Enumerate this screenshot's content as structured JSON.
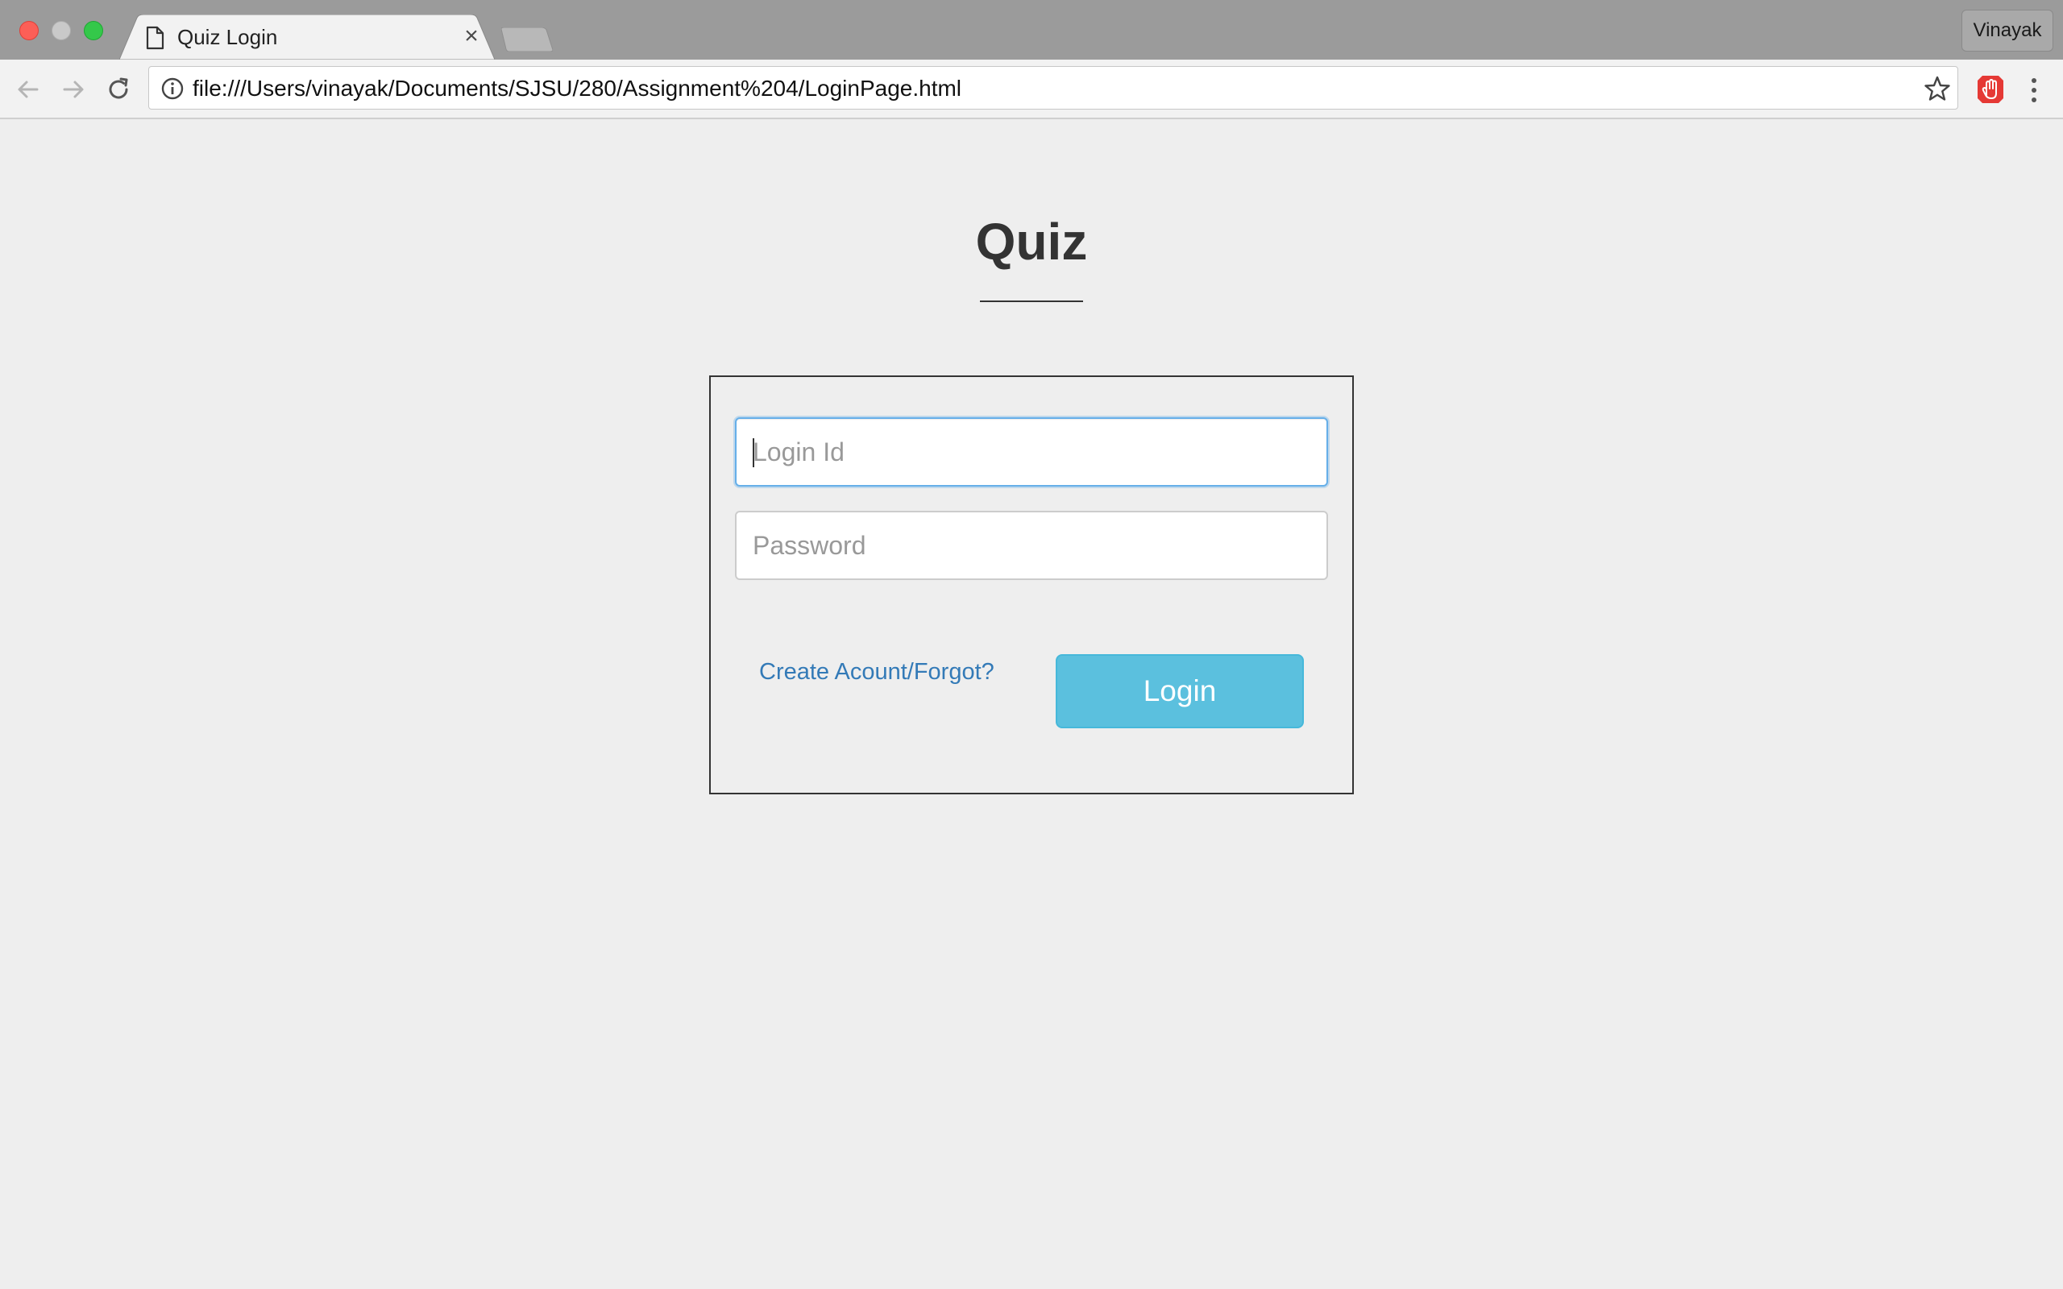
{
  "browser": {
    "tab": {
      "title": "Quiz Login",
      "close_glyph": "×"
    },
    "profile_name": "Vinayak",
    "address_bar": {
      "url": "file:///Users/vinayak/Documents/SJSU/280/Assignment%204/LoginPage.html"
    },
    "icons": {
      "back": "back-arrow-icon",
      "forward": "forward-arrow-icon",
      "reload": "reload-icon",
      "info": "info-icon",
      "bookmark": "star-icon",
      "extension": "ad-blocker-icon",
      "menu": "kebab-menu-icon"
    }
  },
  "page": {
    "heading": "Quiz",
    "login_form": {
      "login_id_placeholder": "Login Id",
      "login_id_value": "",
      "password_placeholder": "Password",
      "password_value": "",
      "account_link": "Create Acount/Forgot?",
      "submit_label": "Login"
    }
  },
  "colors": {
    "page_background": "#eeeeee",
    "link": "#337ab7",
    "button": "#5bc0de",
    "focus_ring": "#66afe9"
  }
}
